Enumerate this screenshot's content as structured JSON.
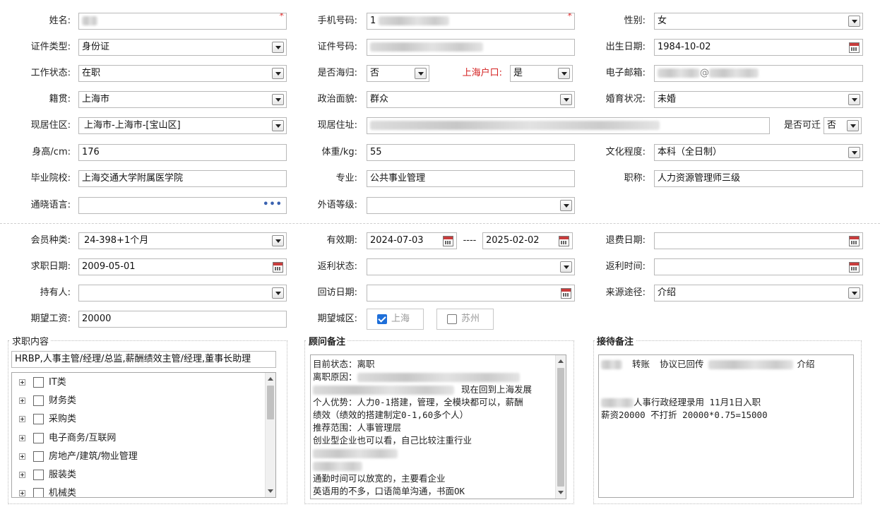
{
  "personal": {
    "name": {
      "label": "姓名:",
      "value": ""
    },
    "phone": {
      "label": "手机号码:",
      "value": "1"
    },
    "gender": {
      "label": "性别:",
      "value": "女"
    },
    "id_type": {
      "label": "证件类型:",
      "value": "身份证"
    },
    "id_no": {
      "label": "证件号码:",
      "value": ""
    },
    "birth": {
      "label": "出生日期:",
      "value": "1984-10-02"
    },
    "work_status": {
      "label": "工作状态:",
      "value": "在职"
    },
    "returnee": {
      "label": "是否海归:",
      "value": "否"
    },
    "hukou": {
      "label": "上海户口:",
      "value": "是"
    },
    "email": {
      "label": "电子邮箱:",
      "value": "@"
    },
    "native": {
      "label": "籍贯:",
      "value": "上海市"
    },
    "politics": {
      "label": "政治面貌:",
      "value": "群众"
    },
    "marital": {
      "label": "婚育状况:",
      "value": "未婚"
    },
    "district": {
      "label": "现居住区:",
      "value": "上海市-上海市-[宝山区]"
    },
    "address": {
      "label": "现居住址:",
      "value": ""
    },
    "relocate": {
      "label": "是否可迁",
      "value": "否"
    },
    "height": {
      "label": "身高/cm:",
      "value": "176"
    },
    "weight": {
      "label": "体重/kg:",
      "value": "55"
    },
    "education": {
      "label": "文化程度:",
      "value": "本科（全日制）"
    },
    "school": {
      "label": "毕业院校:",
      "value": "上海交通大学附属医学院"
    },
    "major": {
      "label": "专业:",
      "value": "公共事业管理"
    },
    "title": {
      "label": "职称:",
      "value": "人力资源管理师三级"
    },
    "language": {
      "label": "通晓语言:",
      "value": "",
      "more": "•••"
    },
    "lang_level": {
      "label": "外语等级:",
      "value": ""
    }
  },
  "membership": {
    "member_type": {
      "label": "会员种类:",
      "value": "24-398+1个月"
    },
    "valid": {
      "label": "有效期:",
      "from": "2024-07-03",
      "sep": "----",
      "to": "2025-02-02"
    },
    "refund_date": {
      "label": "退费日期:",
      "value": ""
    },
    "job_date": {
      "label": "求职日期:",
      "value": "2009-05-01"
    },
    "rebate_status": {
      "label": "返利状态:",
      "value": ""
    },
    "rebate_time": {
      "label": "返利时间:",
      "value": ""
    },
    "holder": {
      "label": "持有人:",
      "value": ""
    },
    "visit_date": {
      "label": "回访日期:",
      "value": ""
    },
    "source": {
      "label": "来源途径:",
      "value": "介绍"
    },
    "salary": {
      "label": "期望工资:",
      "value": "20000"
    },
    "city": {
      "label": "期望城区:",
      "options": [
        {
          "label": "上海",
          "checked": true
        },
        {
          "label": "苏州",
          "checked": false
        }
      ]
    }
  },
  "job_content": {
    "legend": "求职内容",
    "summary": "HRBP,人事主管/经理/总监,薪酬绩效主管/经理,董事长助理",
    "categories": [
      "IT类",
      "财务类",
      "采购类",
      "电子商务/互联网",
      "房地产/建筑/物业管理",
      "服装类",
      "机械类"
    ]
  },
  "consultant_notes": {
    "legend": "顾问备注",
    "lines": [
      "目前状态：离职",
      "离职原因：",
      "现在回到上海发展",
      "个人优势：人力0-1搭建，管理，全模块都可以，薪酬",
      "绩效（绩效的搭建制定0-1,60多个人）",
      "推荐范围：人事管理层",
      "创业型企业也可以看，自己比较注重行业",
      "",
      "",
      "通勤时间可以放宽的，主要看企业",
      "英语用的不多，口语简单沟通，书面OK"
    ]
  },
  "reception_notes": {
    "legend": "接待备注",
    "line1_a": "转账",
    "line1_b": "协议已回传",
    "line1_c": "介绍",
    "line2": "人事行政经理录用 11月1日入职",
    "line3": "薪资20000 不打折 20000*0.75=15000"
  }
}
